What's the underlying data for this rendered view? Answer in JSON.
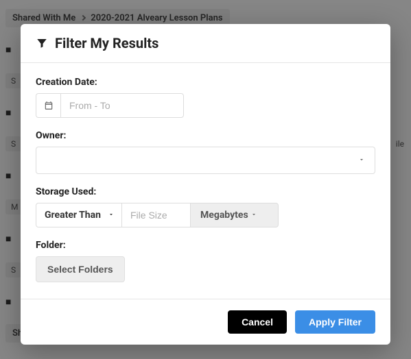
{
  "background": {
    "breadcrumb_root": "Shared With Me",
    "breadcrumb_current": "2020-2021 Alveary Lesson Plans",
    "tag_s": "S",
    "tag_m": "M",
    "right_label": "ile"
  },
  "modal": {
    "title": "Filter My Results",
    "creation_date_label": "Creation Date:",
    "date_placeholder": "From - To",
    "owner_label": "Owner:",
    "storage_label": "Storage Used:",
    "comparator": "Greater Than",
    "filesize_placeholder": "File Size",
    "unit": "Megabytes",
    "folder_label": "Folder:",
    "select_folders_btn": "Select Folders",
    "cancel": "Cancel",
    "apply": "Apply Filter"
  }
}
